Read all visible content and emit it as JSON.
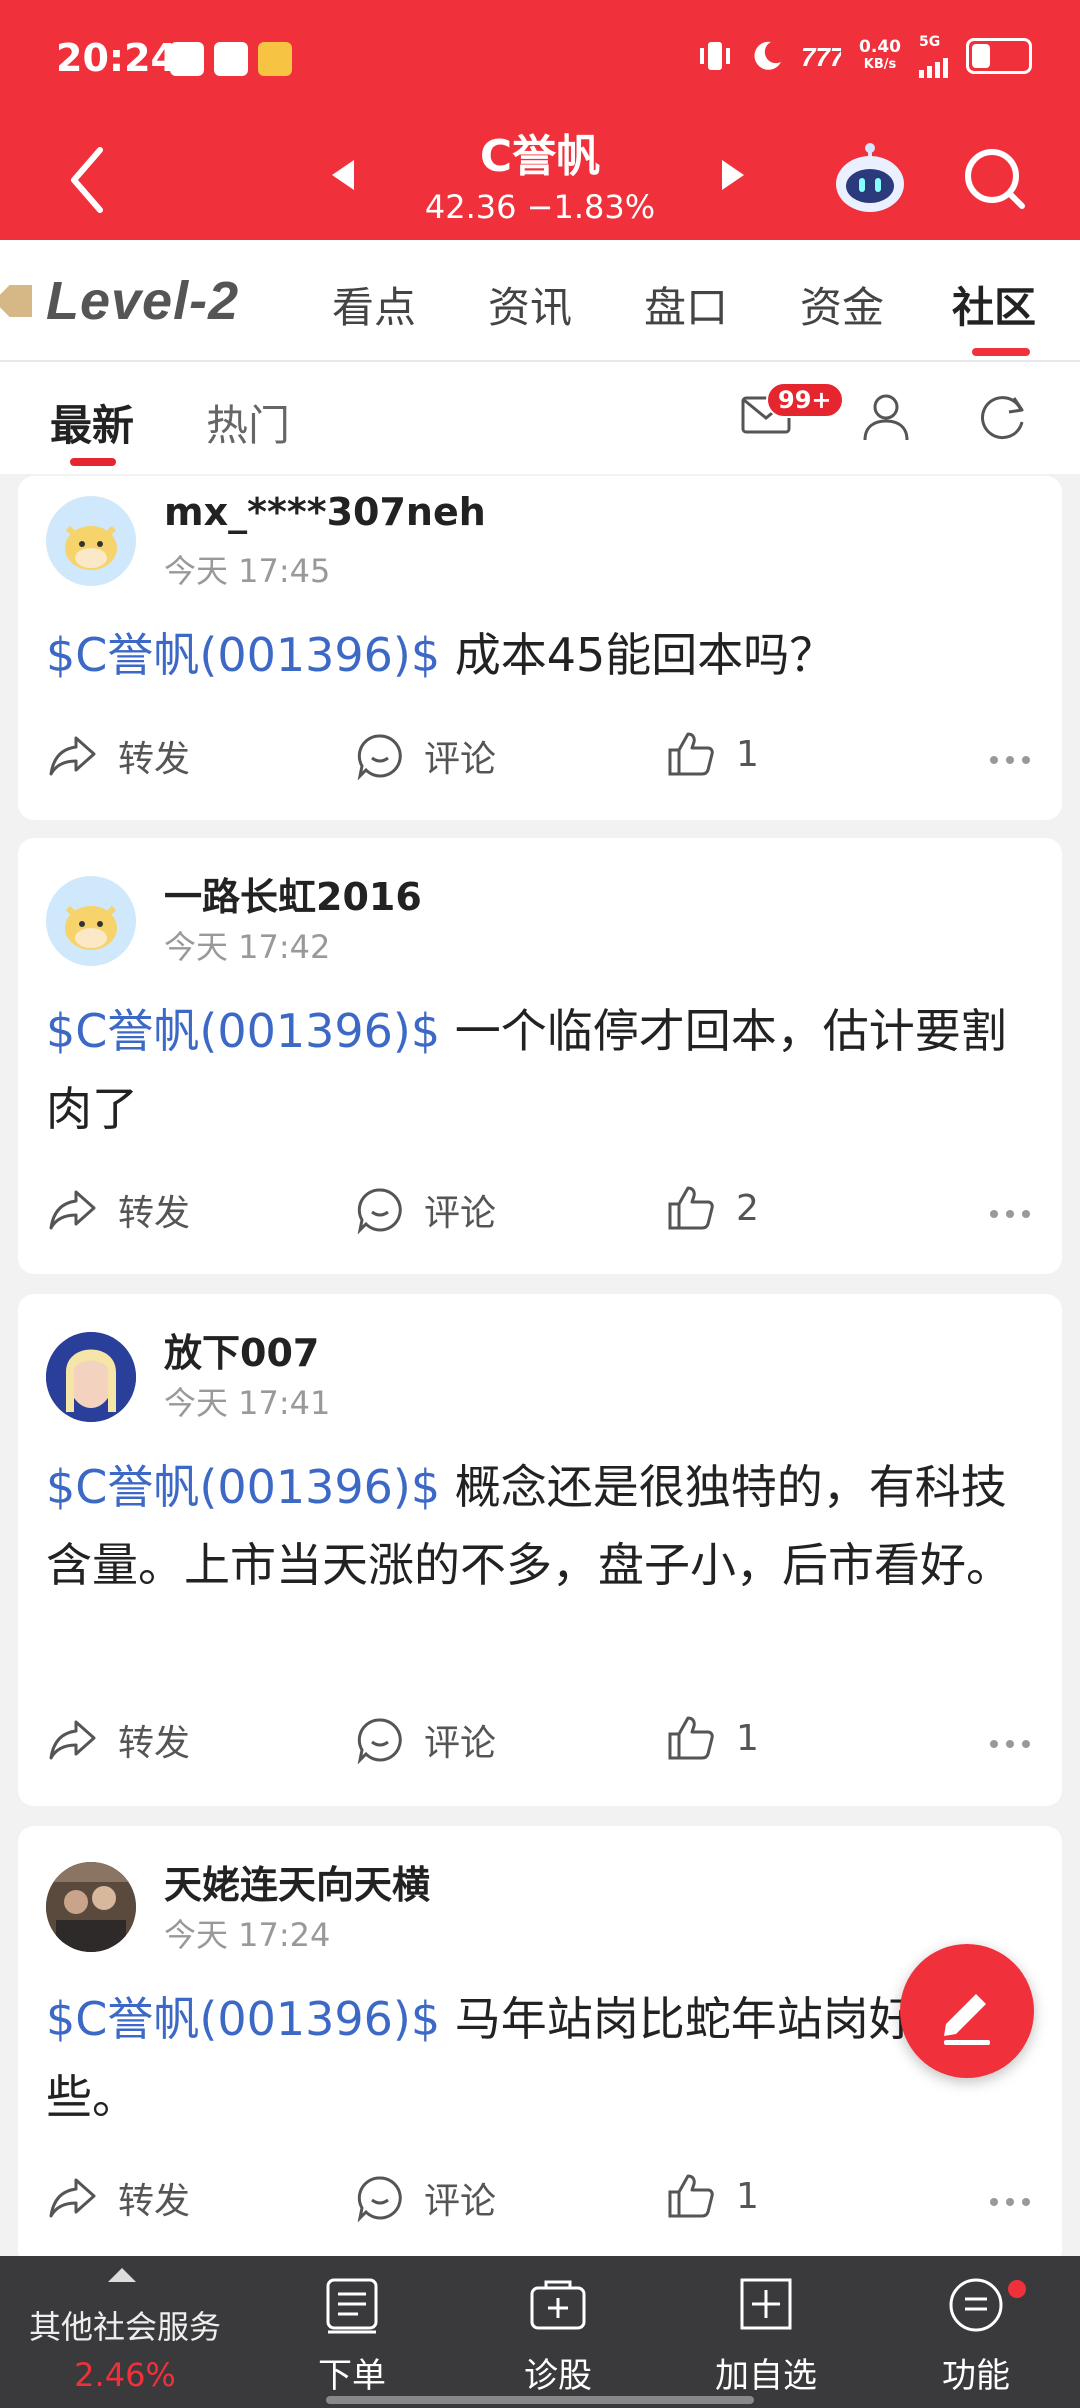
{
  "status_bar": {
    "time": "20:24",
    "net_speed": "0.40",
    "net_unit": "KB/s",
    "network": "5G"
  },
  "header": {
    "title": "C誉帆",
    "quote": "42.36 −1.83%"
  },
  "tabs": {
    "level2": "Level-2",
    "items": [
      "看点",
      "资讯",
      "盘口",
      "资金",
      "社区"
    ],
    "active": "社区"
  },
  "subtabs": {
    "latest": "最新",
    "hot": "热门",
    "badge": "99+"
  },
  "posts": [
    {
      "user": "mx_****307neh",
      "time": "今天 17:45",
      "tag": "$C誉帆(001396)$",
      "text": " 成本45能回本吗？",
      "repost": "转发",
      "comment": "评论",
      "likes": "1"
    },
    {
      "user": "一路长虹2016",
      "time": "今天 17:42",
      "tag": "$C誉帆(001396)$",
      "text": " 一个临停才回本，估计要割肉了",
      "repost": "转发",
      "comment": "评论",
      "likes": "2"
    },
    {
      "user": "放下007",
      "time": "今天 17:41",
      "tag": "$C誉帆(001396)$",
      "text": " 概念还是很独特的，有科技含量。上市当天涨的不多，盘子小，后市看好。",
      "repost": "转发",
      "comment": "评论",
      "likes": "1"
    },
    {
      "user": "天姥连天向天横",
      "time": "今天 17:24",
      "tag": "$C誉帆(001396)$",
      "text": " 马年站岗比蛇年站岗好一些。",
      "repost": "转发",
      "comment": "评论",
      "likes": "1"
    }
  ],
  "bottom_bar": {
    "other_label": "其他社会服务",
    "other_pct": "2.46%",
    "order": "下单",
    "diagnose": "诊股",
    "add_watch": "加自选",
    "functions": "功能"
  },
  "colors": {
    "brand_red": "#f0303a",
    "tag_blue": "#3d69c6",
    "bottom_bg": "#3a3a3c"
  }
}
